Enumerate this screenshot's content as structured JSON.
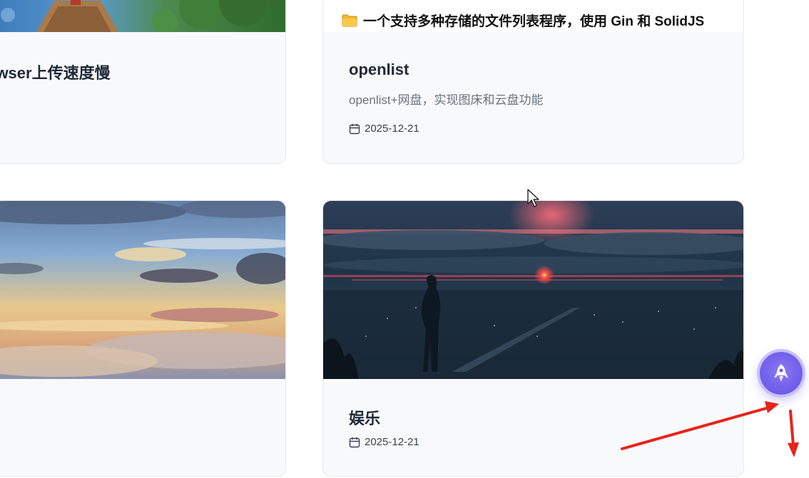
{
  "cards": [
    {
      "title": "owser上传速度慢"
    },
    {
      "banner_text": "一个支持多种存储的文件列表程序，使用 Gin 和 SolidJS",
      "title": "openlist",
      "description": "openlist+网盘，实现图床和云盘功能",
      "date": "2025-12-21"
    },
    {
      "cover": "sky-clouds-sunset"
    },
    {
      "cover": "night-sea-girl-sunset",
      "title": "娱乐",
      "date": "2025-12-21"
    }
  ],
  "icons": {
    "calendar": "calendar-icon",
    "rocket": "rocket-icon",
    "folder": "folder-icon"
  },
  "colors": {
    "accent": "#6d5ce8",
    "annotation_arrow": "#e8231b"
  }
}
